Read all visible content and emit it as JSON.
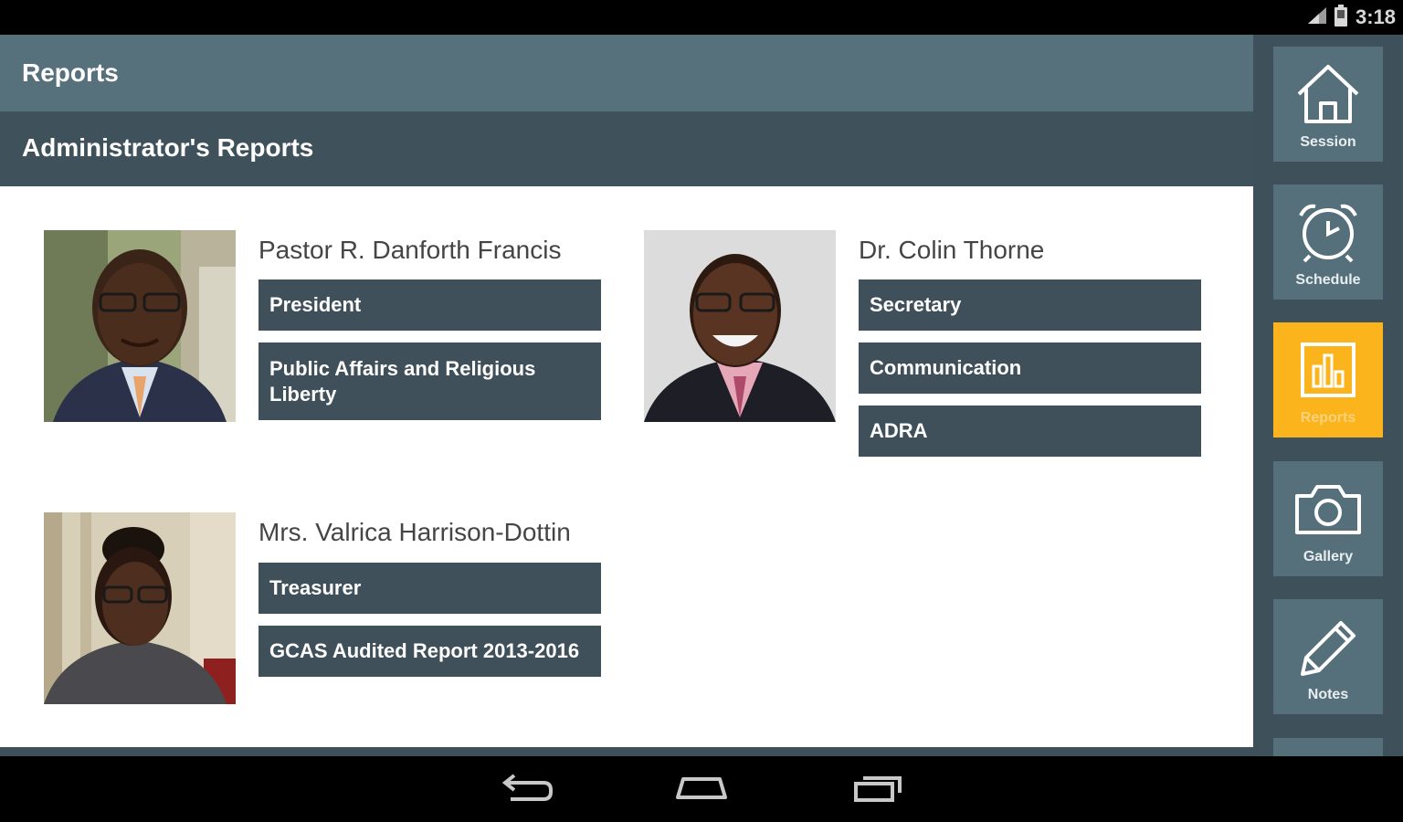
{
  "status": {
    "time": "3:18"
  },
  "header": {
    "title": "Reports",
    "subtitle": "Administrator's Reports"
  },
  "people": [
    {
      "name": "Pastor R. Danforth Francis",
      "reports": [
        "President",
        "Public Affairs and Religious Liberty"
      ]
    },
    {
      "name": "Dr. Colin Thorne",
      "reports": [
        "Secretary",
        "Communication",
        "ADRA"
      ]
    },
    {
      "name": "Mrs. Valrica Harrison-Dottin",
      "reports": [
        "Treasurer",
        "GCAS Audited Report 2013-2016"
      ]
    }
  ],
  "nav": {
    "items": [
      {
        "label": "Session",
        "icon": "home-icon",
        "active": false
      },
      {
        "label": "Schedule",
        "icon": "alarm-clock-icon",
        "active": false
      },
      {
        "label": "Reports",
        "icon": "bar-chart-icon",
        "active": true
      },
      {
        "label": "Gallery",
        "icon": "camera-icon",
        "active": false
      },
      {
        "label": "Notes",
        "icon": "pencil-icon",
        "active": false
      }
    ]
  },
  "colors": {
    "accent": "#fbb41c",
    "header": "#57717c",
    "subheader": "#3f525c",
    "button": "#3f505a"
  }
}
